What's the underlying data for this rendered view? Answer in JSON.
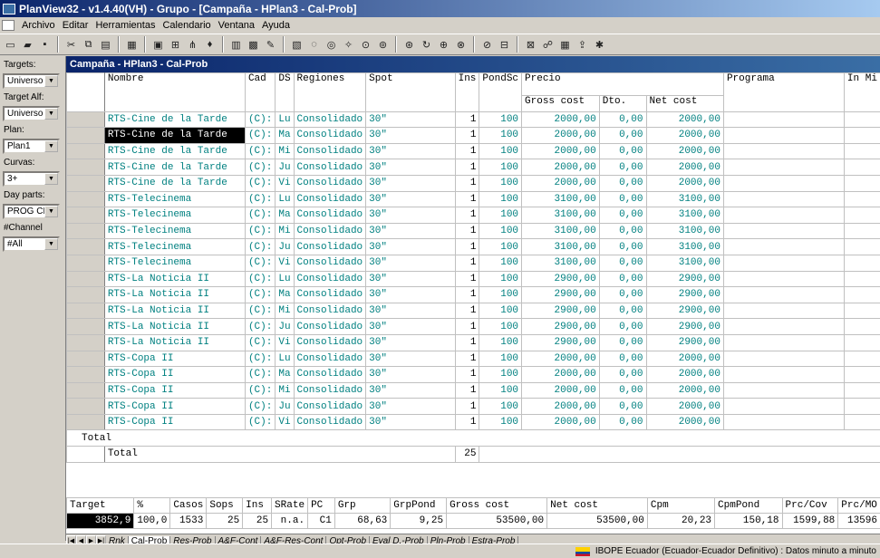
{
  "window": {
    "title": "PlanView32 - v1.4.40(VH) - Grupo - [Campaña - HPlan3 - Cal-Prob]"
  },
  "menu": [
    "Archivo",
    "Editar",
    "Herramientas",
    "Calendario",
    "Ventana",
    "Ayuda"
  ],
  "toolbar_icons": [
    "new-icon",
    "open-icon",
    "save-icon",
    "cut-icon",
    "copy-icon",
    "paste-icon",
    "properties-icon",
    "window-icon",
    "grid-icon",
    "tree-icon",
    "pin-icon",
    "calc-icon",
    "film-icon",
    "chart-icon",
    "report-icon",
    "circle1-icon",
    "circle2-icon",
    "wand-icon",
    "target1-icon",
    "target2-icon",
    "target3-icon",
    "refresh-icon",
    "group1-icon",
    "group2-icon",
    "group3-icon",
    "zoom1-icon",
    "zoom2-icon",
    "link-icon",
    "table-icon",
    "export-icon",
    "star-icon"
  ],
  "filters": [
    {
      "label": "Targets:",
      "value": "Universo"
    },
    {
      "label": "Target Alf:",
      "value": ""
    },
    {
      "label": "",
      "value": "Universo"
    },
    {
      "label": "Plan:",
      "value": "Plan1"
    },
    {
      "label": "Curvas:",
      "value": "3+"
    },
    {
      "label": "Day parts:",
      "value": "PROG CHN"
    },
    {
      "label": "#Channel",
      "value": "#All"
    }
  ],
  "child": {
    "title": "Campaña - HPlan3 - Cal-Prob"
  },
  "headers": {
    "nombre": "Nombre",
    "cad": "Cad",
    "ds": "DS",
    "regiones": "Regiones",
    "spot": "Spot",
    "ins": "Ins",
    "pondsc": "PondSc",
    "precio": "Precio",
    "gross": "Gross cost",
    "dto": "Dto.",
    "net": "Net cost",
    "programa": "Programa",
    "extra": "In Mi"
  },
  "rows": [
    {
      "nombre": "RTS-Cine de la Tarde",
      "cad": "(C):",
      "ds": "Lu",
      "reg": "Consolidado",
      "spot": "30\"",
      "ins": "1",
      "pond": "100",
      "gross": "2000,00",
      "dto": "0,00",
      "net": "2000,00"
    },
    {
      "nombre": "RTS-Cine de la Tarde",
      "cad": "(C):",
      "ds": "Ma",
      "reg": "Consolidado",
      "spot": "30\"",
      "ins": "1",
      "pond": "100",
      "gross": "2000,00",
      "dto": "0,00",
      "net": "2000,00",
      "selected": true
    },
    {
      "nombre": "RTS-Cine de la Tarde",
      "cad": "(C):",
      "ds": "Mi",
      "reg": "Consolidado",
      "spot": "30\"",
      "ins": "1",
      "pond": "100",
      "gross": "2000,00",
      "dto": "0,00",
      "net": "2000,00"
    },
    {
      "nombre": "RTS-Cine de la Tarde",
      "cad": "(C):",
      "ds": "Ju",
      "reg": "Consolidado",
      "spot": "30\"",
      "ins": "1",
      "pond": "100",
      "gross": "2000,00",
      "dto": "0,00",
      "net": "2000,00"
    },
    {
      "nombre": "RTS-Cine de la Tarde",
      "cad": "(C):",
      "ds": "Vi",
      "reg": "Consolidado",
      "spot": "30\"",
      "ins": "1",
      "pond": "100",
      "gross": "2000,00",
      "dto": "0,00",
      "net": "2000,00"
    },
    {
      "nombre": "RTS-Telecinema",
      "cad": "(C):",
      "ds": "Lu",
      "reg": "Consolidado",
      "spot": "30\"",
      "ins": "1",
      "pond": "100",
      "gross": "3100,00",
      "dto": "0,00",
      "net": "3100,00"
    },
    {
      "nombre": "RTS-Telecinema",
      "cad": "(C):",
      "ds": "Ma",
      "reg": "Consolidado",
      "spot": "30\"",
      "ins": "1",
      "pond": "100",
      "gross": "3100,00",
      "dto": "0,00",
      "net": "3100,00"
    },
    {
      "nombre": "RTS-Telecinema",
      "cad": "(C):",
      "ds": "Mi",
      "reg": "Consolidado",
      "spot": "30\"",
      "ins": "1",
      "pond": "100",
      "gross": "3100,00",
      "dto": "0,00",
      "net": "3100,00"
    },
    {
      "nombre": "RTS-Telecinema",
      "cad": "(C):",
      "ds": "Ju",
      "reg": "Consolidado",
      "spot": "30\"",
      "ins": "1",
      "pond": "100",
      "gross": "3100,00",
      "dto": "0,00",
      "net": "3100,00"
    },
    {
      "nombre": "RTS-Telecinema",
      "cad": "(C):",
      "ds": "Vi",
      "reg": "Consolidado",
      "spot": "30\"",
      "ins": "1",
      "pond": "100",
      "gross": "3100,00",
      "dto": "0,00",
      "net": "3100,00"
    },
    {
      "nombre": "RTS-La Noticia II",
      "cad": "(C):",
      "ds": "Lu",
      "reg": "Consolidado",
      "spot": "30\"",
      "ins": "1",
      "pond": "100",
      "gross": "2900,00",
      "dto": "0,00",
      "net": "2900,00"
    },
    {
      "nombre": "RTS-La Noticia II",
      "cad": "(C):",
      "ds": "Ma",
      "reg": "Consolidado",
      "spot": "30\"",
      "ins": "1",
      "pond": "100",
      "gross": "2900,00",
      "dto": "0,00",
      "net": "2900,00"
    },
    {
      "nombre": "RTS-La Noticia II",
      "cad": "(C):",
      "ds": "Mi",
      "reg": "Consolidado",
      "spot": "30\"",
      "ins": "1",
      "pond": "100",
      "gross": "2900,00",
      "dto": "0,00",
      "net": "2900,00"
    },
    {
      "nombre": "RTS-La Noticia II",
      "cad": "(C):",
      "ds": "Ju",
      "reg": "Consolidado",
      "spot": "30\"",
      "ins": "1",
      "pond": "100",
      "gross": "2900,00",
      "dto": "0,00",
      "net": "2900,00"
    },
    {
      "nombre": "RTS-La Noticia II",
      "cad": "(C):",
      "ds": "Vi",
      "reg": "Consolidado",
      "spot": "30\"",
      "ins": "1",
      "pond": "100",
      "gross": "2900,00",
      "dto": "0,00",
      "net": "2900,00"
    },
    {
      "nombre": "RTS-Copa II",
      "cad": "(C):",
      "ds": "Lu",
      "reg": "Consolidado",
      "spot": "30\"",
      "ins": "1",
      "pond": "100",
      "gross": "2000,00",
      "dto": "0,00",
      "net": "2000,00"
    },
    {
      "nombre": "RTS-Copa II",
      "cad": "(C):",
      "ds": "Ma",
      "reg": "Consolidado",
      "spot": "30\"",
      "ins": "1",
      "pond": "100",
      "gross": "2000,00",
      "dto": "0,00",
      "net": "2000,00"
    },
    {
      "nombre": "RTS-Copa II",
      "cad": "(C):",
      "ds": "Mi",
      "reg": "Consolidado",
      "spot": "30\"",
      "ins": "1",
      "pond": "100",
      "gross": "2000,00",
      "dto": "0,00",
      "net": "2000,00"
    },
    {
      "nombre": "RTS-Copa II",
      "cad": "(C):",
      "ds": "Ju",
      "reg": "Consolidado",
      "spot": "30\"",
      "ins": "1",
      "pond": "100",
      "gross": "2000,00",
      "dto": "0,00",
      "net": "2000,00"
    },
    {
      "nombre": "RTS-Copa II",
      "cad": "(C):",
      "ds": "Vi",
      "reg": "Consolidado",
      "spot": "30\"",
      "ins": "1",
      "pond": "100",
      "gross": "2000,00",
      "dto": "0,00",
      "net": "2000,00"
    }
  ],
  "totals": {
    "label": "Total",
    "label2": "Total",
    "ins": "25"
  },
  "tabs": [
    "Rnk",
    "Cal-Prob",
    "Res-Prob",
    "A&F-Cont",
    "A&F-Res-Cont",
    "Opt-Prob",
    "Eval D.-Prob",
    "Pln-Prob",
    "Estra-Prob"
  ],
  "active_tab": "Cal-Prob",
  "summary": {
    "headers": [
      "Target",
      "%",
      "Casos",
      "Sops",
      "Ins",
      "SRate",
      "PC",
      "Grp",
      "GrpPond",
      "Gross cost",
      "Net cost",
      "Cpm",
      "CpmPond",
      "Prc/Cov",
      "Prc/MO"
    ],
    "values": [
      "3852,9",
      "100,0",
      "1533",
      "25",
      "25",
      "n.a.",
      "C1",
      "68,63",
      "9,25",
      "53500,00",
      "53500,00",
      "20,23",
      "150,18",
      "1599,88",
      "13596"
    ]
  },
  "status": {
    "text": "IBOPE Ecuador (Ecuador-Ecuador Definitivo) : Datos minuto a minuto"
  }
}
